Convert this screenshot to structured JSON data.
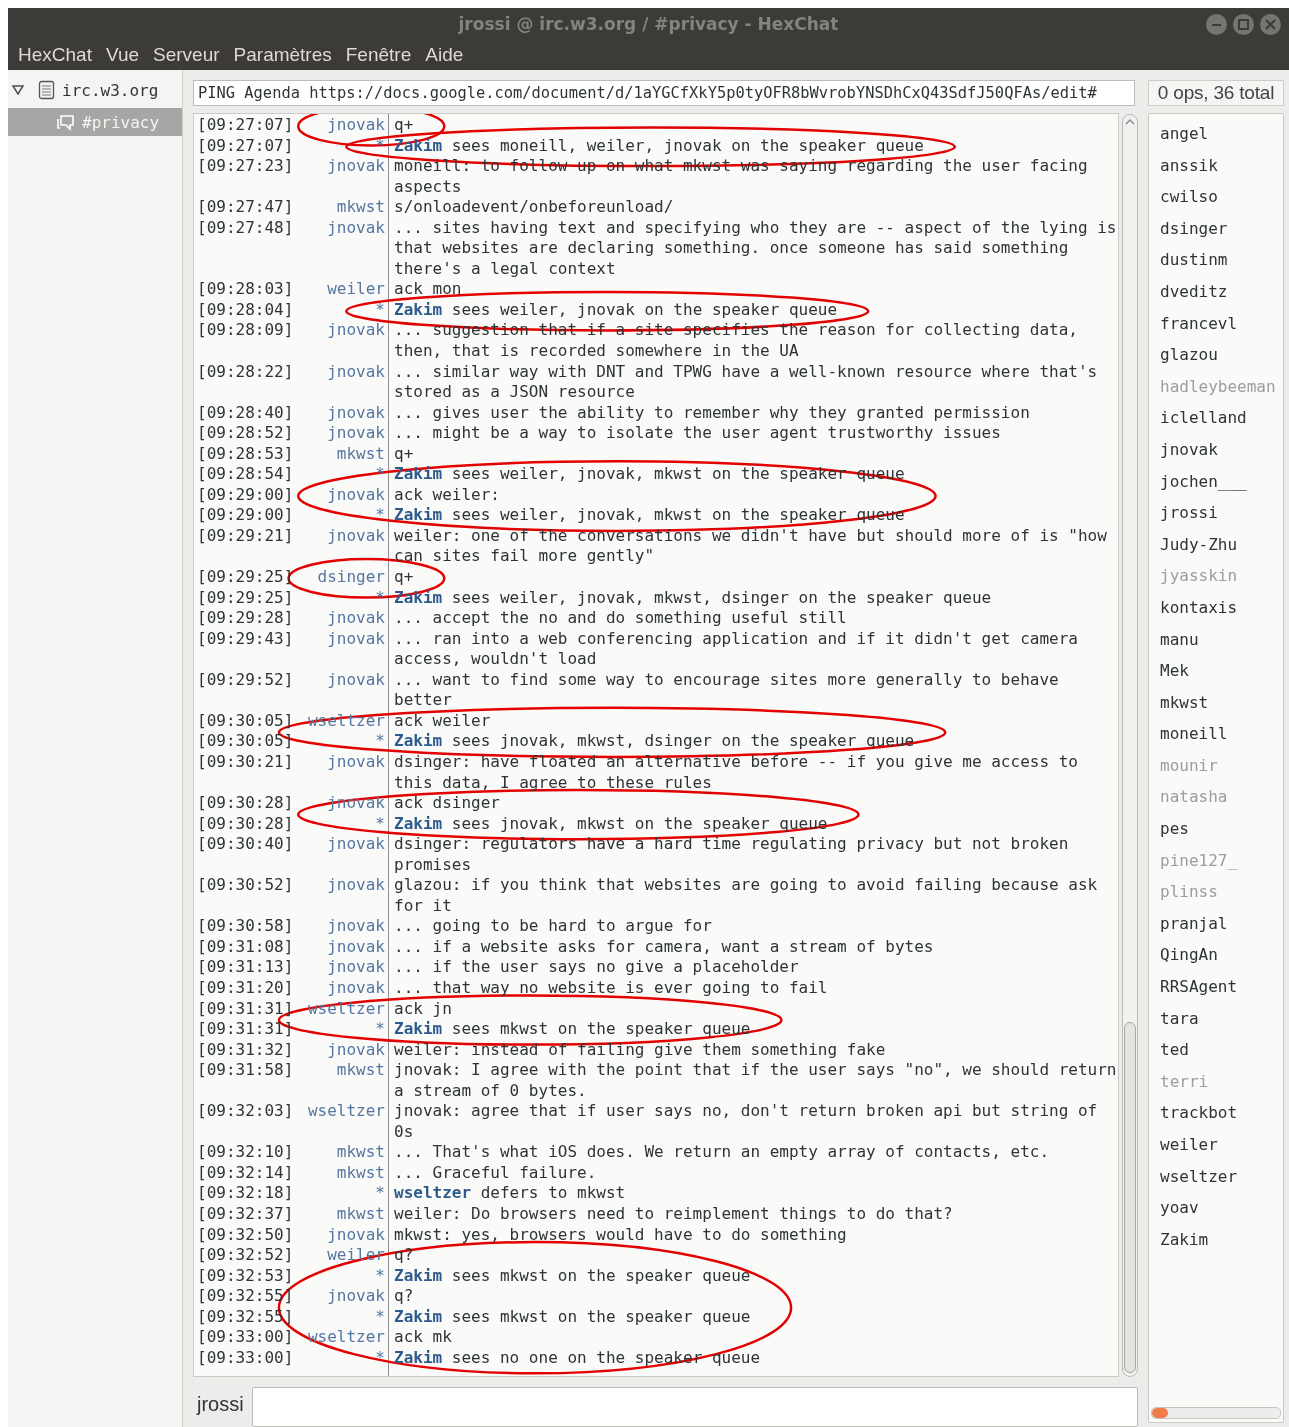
{
  "window": {
    "title": "jrossi @ irc.w3.org / #privacy - HexChat"
  },
  "menu": [
    "HexChat",
    "Vue",
    "Serveur",
    "Paramètres",
    "Fenêtre",
    "Aide"
  ],
  "server_tree": [
    {
      "label": "irc.w3.org",
      "expanded": true,
      "selected": false,
      "children": [
        {
          "label": "#privacy",
          "selected": true
        }
      ]
    }
  ],
  "topic": {
    "value": "PING Agenda https://docs.google.com/document/d/1aYGCfXkY5p0tyOFR8bWvrobYNSDhCxQ43SdfJ50QFAs/edit#"
  },
  "user_count": "0 ops, 36 total",
  "chat": [
    {
      "kind": "circled",
      "messages": [
        {
          "kind": "message",
          "time": "[09:27:07]",
          "nick": "jnovak",
          "text": "q+"
        }
      ]
    },
    {
      "kind": "circled",
      "messages": [
        {
          "kind": "action",
          "time": "[09:27:07]",
          "nick": "*",
          "actor": "Zakim",
          "text": "sees moneill, weiler, jnovak on the speaker queue"
        }
      ]
    },
    {
      "kind": "message",
      "time": "[09:27:23]",
      "nick": "jnovak",
      "text": "moneill: to follow up on what mkwst was saying regarding the user facing aspects"
    },
    {
      "kind": "message",
      "time": "[09:27:47]",
      "nick": "mkwst",
      "text": "s/onloadevent/onbeforeunload/"
    },
    {
      "kind": "message",
      "time": "[09:27:48]",
      "nick": "jnovak",
      "text": "... sites having text and specifying who they are -- aspect of the lying is that websites are declaring something. once someone has said something there's a legal context"
    },
    {
      "kind": "message",
      "time": "[09:28:03]",
      "nick": "weiler",
      "text": "ack mon"
    },
    {
      "kind": "circled",
      "messages": [
        {
          "kind": "action",
          "time": "[09:28:04]",
          "nick": "*",
          "actor": "Zakim",
          "text": "sees weiler, jnovak on the speaker queue"
        }
      ]
    },
    {
      "kind": "message",
      "time": "[09:28:09]",
      "nick": "jnovak",
      "text": "... suggestion that if a site specifies the reason for collecting data, then, that is recorded somewhere in the UA"
    },
    {
      "kind": "message",
      "time": "[09:28:22]",
      "nick": "jnovak",
      "text": "... similar way with DNT and TPWG have a well-known resource where that's stored as a JSON resource"
    },
    {
      "kind": "message",
      "time": "[09:28:40]",
      "nick": "jnovak",
      "text": "... gives user the ability to remember why they granted permission"
    },
    {
      "kind": "message",
      "time": "[09:28:52]",
      "nick": "jnovak",
      "text": "... might be a way to isolate the user agent trustworthy issues"
    },
    {
      "kind": "message",
      "time": "[09:28:53]",
      "nick": "mkwst",
      "text": "q+"
    },
    {
      "kind": "circled",
      "messages": [
        {
          "kind": "action",
          "time": "[09:28:54]",
          "nick": "*",
          "actor": "Zakim",
          "text": "sees weiler, jnovak, mkwst on the speaker queue"
        },
        {
          "kind": "message",
          "time": "[09:29:00]",
          "nick": "jnovak",
          "text": "ack weiler:"
        },
        {
          "kind": "action",
          "time": "[09:29:00]",
          "nick": "*",
          "actor": "Zakim",
          "text": "sees weiler, jnovak, mkwst on the speaker queue"
        }
      ]
    },
    {
      "kind": "message",
      "time": "[09:29:21]",
      "nick": "jnovak",
      "text": "weiler: one of the conversations we didn't have but should more of is \"how can sites fail more gently\""
    },
    {
      "kind": "circled",
      "messages": [
        {
          "kind": "message",
          "time": "[09:29:25]",
          "nick": "dsinger",
          "text": "q+"
        }
      ]
    },
    {
      "kind": "action",
      "time": "[09:29:25]",
      "nick": "*",
      "actor": "Zakim",
      "text": "sees weiler, jnovak, mkwst, dsinger on the speaker queue"
    },
    {
      "kind": "message",
      "time": "[09:29:28]",
      "nick": "jnovak",
      "text": "... accept the no and do something useful still"
    },
    {
      "kind": "message",
      "time": "[09:29:43]",
      "nick": "jnovak",
      "text": "... ran into a web conferencing application and if it didn't get camera access, wouldn't load"
    },
    {
      "kind": "message",
      "time": "[09:29:52]",
      "nick": "jnovak",
      "text": "... want to find some way to encourage sites more generally to behave better"
    },
    {
      "kind": "circled",
      "messages": [
        {
          "kind": "message",
          "time": "[09:30:05]",
          "nick": "wseltzer",
          "text": "ack weiler"
        },
        {
          "kind": "action",
          "time": "[09:30:05]",
          "nick": "*",
          "actor": "Zakim",
          "text": "sees jnovak, mkwst, dsinger on the speaker queue"
        }
      ]
    },
    {
      "kind": "message",
      "time": "[09:30:21]",
      "nick": "jnovak",
      "text": "dsinger: have floated an alternative before -- if you give me access to this data, I agree to these rules"
    },
    {
      "kind": "circled",
      "messages": [
        {
          "kind": "message",
          "time": "[09:30:28]",
          "nick": "jnovak",
          "text": "ack dsinger"
        },
        {
          "kind": "action",
          "time": "[09:30:28]",
          "nick": "*",
          "actor": "Zakim",
          "text": "sees jnovak, mkwst on the speaker queue"
        }
      ]
    },
    {
      "kind": "message",
      "time": "[09:30:40]",
      "nick": "jnovak",
      "text": "dsinger: regulators have a hard time regulating privacy but not broken promises"
    },
    {
      "kind": "message",
      "time": "[09:30:52]",
      "nick": "jnovak",
      "text": "glazou: if you think that websites are going to avoid failing because ask for it"
    },
    {
      "kind": "message",
      "time": "[09:30:58]",
      "nick": "jnovak",
      "text": "... going to be hard to argue for"
    },
    {
      "kind": "message",
      "time": "[09:31:08]",
      "nick": "jnovak",
      "text": "... if a website asks for camera, want a stream of bytes"
    },
    {
      "kind": "message",
      "time": "[09:31:13]",
      "nick": "jnovak",
      "text": "... if the user says no give a placeholder"
    },
    {
      "kind": "message",
      "time": "[09:31:20]",
      "nick": "jnovak",
      "text": "... that way no website is ever going to fail"
    },
    {
      "kind": "circled",
      "messages": [
        {
          "kind": "message",
          "time": "[09:31:31]",
          "nick": "wseltzer",
          "text": "ack jn"
        },
        {
          "kind": "action",
          "time": "[09:31:31]",
          "nick": "*",
          "actor": "Zakim",
          "text": "sees mkwst on the speaker queue"
        }
      ]
    },
    {
      "kind": "message",
      "time": "[09:31:32]",
      "nick": "jnovak",
      "text": "weiler: instead of failing give them something fake"
    },
    {
      "kind": "message",
      "time": "[09:31:58]",
      "nick": "mkwst",
      "text": "jnovak: I agree with the point that if the user says \"no\", we should return a stream of 0 bytes."
    },
    {
      "kind": "message",
      "time": "[09:32:03]",
      "nick": "wseltzer",
      "text": "jnovak: agree that if user says no, don't return broken api but string of 0s"
    },
    {
      "kind": "message",
      "time": "[09:32:10]",
      "nick": "mkwst",
      "text": "... That's what iOS does. We return an empty array of contacts, etc."
    },
    {
      "kind": "message",
      "time": "[09:32:14]",
      "nick": "mkwst",
      "text": "... Graceful failure."
    },
    {
      "kind": "action",
      "time": "[09:32:18]",
      "nick": "*",
      "actor": "wseltzer",
      "text": "defers to mkwst"
    },
    {
      "kind": "message",
      "time": "[09:32:37]",
      "nick": "mkwst",
      "text": "weiler: Do browsers need to reimplement things to do that?"
    },
    {
      "kind": "message",
      "time": "[09:32:50]",
      "nick": "jnovak",
      "text": "mkwst: yes, browsers would have to do something"
    },
    {
      "kind": "circled",
      "messages": [
        {
          "kind": "message",
          "time": "[09:32:52]",
          "nick": "weiler",
          "text": "q?"
        },
        {
          "kind": "action",
          "time": "[09:32:53]",
          "nick": "*",
          "actor": "Zakim",
          "text": "sees mkwst on the speaker queue"
        },
        {
          "kind": "message",
          "time": "[09:32:55]",
          "nick": "jnovak",
          "text": "q?"
        },
        {
          "kind": "action",
          "time": "[09:32:55]",
          "nick": "*",
          "actor": "Zakim",
          "text": "sees mkwst on the speaker queue"
        },
        {
          "kind": "message",
          "time": "[09:33:00]",
          "nick": "wseltzer",
          "text": "ack mk"
        },
        {
          "kind": "action",
          "time": "[09:33:00]",
          "nick": "*",
          "actor": "Zakim",
          "text": "sees no one on the speaker queue"
        }
      ]
    }
  ],
  "users": [
    {
      "name": "angel",
      "away": false
    },
    {
      "name": "anssik",
      "away": false
    },
    {
      "name": "cwilso",
      "away": false
    },
    {
      "name": "dsinger",
      "away": false
    },
    {
      "name": "dustinm",
      "away": false
    },
    {
      "name": "dveditz",
      "away": false
    },
    {
      "name": "francevl",
      "away": false
    },
    {
      "name": "glazou",
      "away": false
    },
    {
      "name": "hadleybeeman",
      "away": true
    },
    {
      "name": "iclelland",
      "away": false
    },
    {
      "name": "jnovak",
      "away": false
    },
    {
      "name": "jochen___",
      "away": false
    },
    {
      "name": "jrossi",
      "away": false
    },
    {
      "name": "Judy-Zhu",
      "away": false
    },
    {
      "name": "jyasskin",
      "away": true
    },
    {
      "name": "kontaxis",
      "away": false
    },
    {
      "name": "manu",
      "away": false
    },
    {
      "name": "Mek",
      "away": false
    },
    {
      "name": "mkwst",
      "away": false
    },
    {
      "name": "moneill",
      "away": false
    },
    {
      "name": "mounir",
      "away": true
    },
    {
      "name": "natasha",
      "away": true
    },
    {
      "name": "pes",
      "away": false
    },
    {
      "name": "pine127_",
      "away": true
    },
    {
      "name": "plinss",
      "away": true
    },
    {
      "name": "pranjal",
      "away": false
    },
    {
      "name": "QingAn",
      "away": false
    },
    {
      "name": "RRSAgent",
      "away": false
    },
    {
      "name": "tara",
      "away": false
    },
    {
      "name": "ted",
      "away": false
    },
    {
      "name": "terri",
      "away": true
    },
    {
      "name": "trackbot",
      "away": false
    },
    {
      "name": "weiler",
      "away": false
    },
    {
      "name": "wseltzer",
      "away": false
    },
    {
      "name": "yoav",
      "away": false
    },
    {
      "name": "Zakim",
      "away": false
    }
  ],
  "input": {
    "nick": "jrossi"
  }
}
